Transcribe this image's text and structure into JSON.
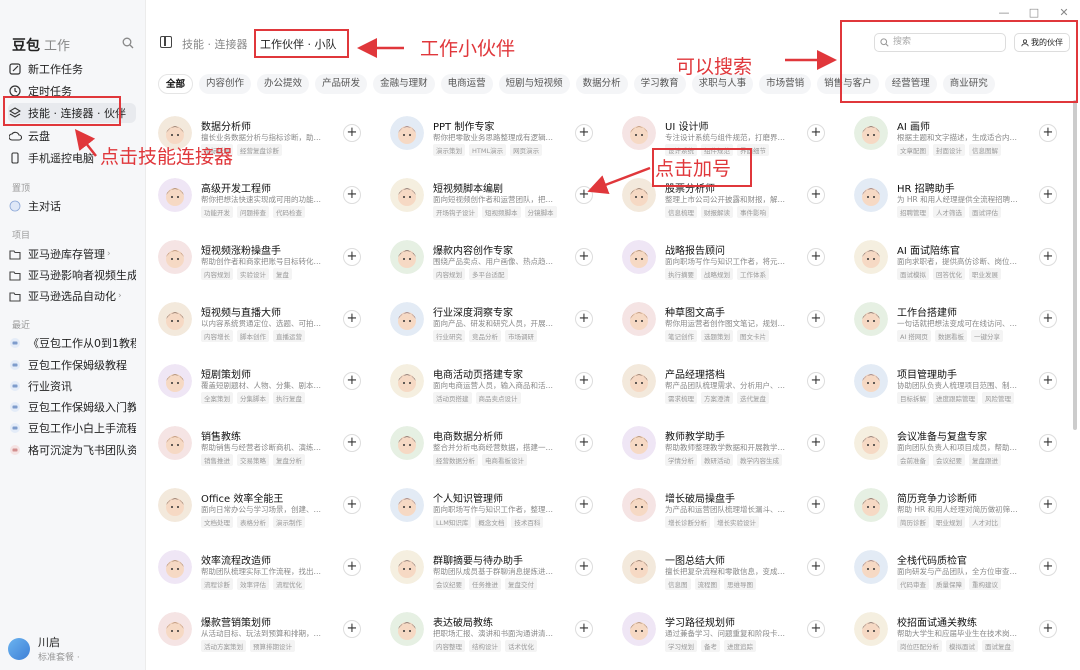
{
  "window": {
    "minimize": "—",
    "maximize": "□",
    "close": "✕"
  },
  "sidebar": {
    "brand": "豆包",
    "brand_sub": "工作",
    "items": [
      {
        "label": "新工作任务",
        "icon": "edit-icon"
      },
      {
        "label": "定时任务",
        "icon": "clock-icon"
      },
      {
        "label": "技能 · 连接器 · 伙伴",
        "icon": "layers-icon",
        "active": true
      },
      {
        "label": "云盘",
        "icon": "cloud-icon"
      },
      {
        "label": "手机遥控电脑",
        "icon": "phone-icon"
      }
    ],
    "section_pinned": "置顶",
    "pinned": [
      {
        "label": "主对话"
      }
    ],
    "section_projects": "项目",
    "projects": [
      {
        "label": "亚马逊库存管理"
      },
      {
        "label": "亚马逊影响者视频生成"
      },
      {
        "label": "亚马逊选品自动化"
      }
    ],
    "section_recent": "最近",
    "recent": [
      {
        "label": "《豆包工作从0到1教程》"
      },
      {
        "label": "豆包工作保姆级教程"
      },
      {
        "label": "行业资讯"
      },
      {
        "label": "豆包工作保姆级入门教程"
      },
      {
        "label": "豆包工作小白上手流程"
      },
      {
        "label": "格可沉淀为飞书团队资产"
      }
    ],
    "user_name": "川启",
    "user_plan": "标准套餐 ·"
  },
  "topbar": {
    "crumb": "技能 · 连接器",
    "active": "工作伙伴 · 小队",
    "search_placeholder": "搜索",
    "partner_label": "我的伙伴"
  },
  "categories": [
    "全部",
    "内容创作",
    "办公提效",
    "产品研发",
    "金融与理财",
    "电商运营",
    "短剧与短视频",
    "数据分析",
    "学习教育",
    "求职与人事",
    "市场营销",
    "销售与客户",
    "经营管理",
    "商业研究"
  ],
  "cards": [
    {
      "name": "数据分析师",
      "desc": "擅长业务数据分析与指标诊断，助…",
      "tags": [
        "指标拆解",
        "经营复盘诊断"
      ]
    },
    {
      "name": "PPT 制作专家",
      "desc": "帮你把零散业务思路整理成有逻辑…",
      "tags": [
        "演示策划",
        "HTML演示",
        "网页演示"
      ]
    },
    {
      "name": "UI 设计师",
      "desc": "专注设计系统与组件规范，打磨界…",
      "tags": [
        "设计系统",
        "组件规范",
        "界面细节"
      ]
    },
    {
      "name": "AI 画师",
      "desc": "根据主题和文字描述，生成适合内…",
      "tags": [
        "文章配图",
        "封面设计",
        "信息图解"
      ]
    },
    {
      "name": "高级开发工程师",
      "desc": "帮你把想法快速实现成可用的功能…",
      "tags": [
        "功能开发",
        "问题排查",
        "代码检查"
      ]
    },
    {
      "name": "短视频脚本编剧",
      "desc": "面向短视频创作者和运营团队，把…",
      "tags": [
        "开场钩子设计",
        "短视频脚本",
        "分镜脚本"
      ]
    },
    {
      "name": "股票分析师",
      "desc": "整理上市公司公开披露和财报，解…",
      "tags": [
        "信息梳理",
        "财报解读",
        "事件影响"
      ]
    },
    {
      "name": "HR 招聘助手",
      "desc": "为 HR 和用人经理提供全流程招聘…",
      "tags": [
        "招聘管理",
        "人才筛选",
        "面试评估"
      ]
    },
    {
      "name": "短视频涨粉操盘手",
      "desc": "帮助创作者和商家把账号目标转化…",
      "tags": [
        "内容规划",
        "实验设计",
        "复盘"
      ]
    },
    {
      "name": "爆款内容创作专家",
      "desc": "围绕产品卖点、用户画像、热点趋…",
      "tags": [
        "内容规划",
        "多平台适配"
      ]
    },
    {
      "name": "战略报告顾问",
      "desc": "面向职场写作与知识工作者，将元…",
      "tags": [
        "执行摘要",
        "战略规划",
        "工作体系"
      ]
    },
    {
      "name": "AI 面试陪练官",
      "desc": "面向求职者，提供高仿诊断、岗位…",
      "tags": [
        "面试模拟",
        "回答优化",
        "职业发展"
      ]
    },
    {
      "name": "短视频与直播大师",
      "desc": "以内容系统贯通定位、选题、可拍…",
      "tags": [
        "内容增长",
        "脚本创作",
        "直播运营"
      ]
    },
    {
      "name": "行业深度洞察专家",
      "desc": "面向产品、研发和研究人员，开展…",
      "tags": [
        "行业研究",
        "竞品分析",
        "市场调研"
      ]
    },
    {
      "name": "种草图文高手",
      "desc": "帮你用运营者创作图文笔记，规划…",
      "tags": [
        "笔记创作",
        "选题策划",
        "图文卡片"
      ]
    },
    {
      "name": "工作台搭建师",
      "desc": "一句话就把想法变成可在线访问、…",
      "tags": [
        "AI 搭网页",
        "数据看板",
        "一键分享"
      ]
    },
    {
      "name": "短剧策划师",
      "desc": "覆盖短剧题材、人物、分集、剧本…",
      "tags": [
        "全案策划",
        "分集脚本",
        "执行复盘"
      ]
    },
    {
      "name": "电商活动页搭建专家",
      "desc": "面向电商运营人员，输入商品和活…",
      "tags": [
        "活动页搭建",
        "商品卖点设计"
      ]
    },
    {
      "name": "产品经理搭档",
      "desc": "帮产品团队梳理需求、分析用户、…",
      "tags": [
        "需求梳理",
        "方案澄清",
        "迭代复盘"
      ]
    },
    {
      "name": "项目管理助手",
      "desc": "协助团队负责人梳理项目范围、制…",
      "tags": [
        "目标拆解",
        "进度跟踪管理",
        "风险管理"
      ]
    },
    {
      "name": "销售教练",
      "desc": "帮助销售与经营者诊断商机、演练…",
      "tags": [
        "销售推进",
        "交易策略",
        "复盘分析"
      ]
    },
    {
      "name": "电商数据分析师",
      "desc": "整合并分析电商经营数据，搭建一…",
      "tags": [
        "经营数据分析",
        "电商看板设计"
      ]
    },
    {
      "name": "教师教学助手",
      "desc": "帮助教师整理教学数据和开展教学…",
      "tags": [
        "学情分析",
        "教研活动",
        "教学内容生成"
      ]
    },
    {
      "name": "会议准备与复盘专家",
      "desc": "面向团队负责人和项目成员，帮助…",
      "tags": [
        "会前准备",
        "会议纪要",
        "复盘跟进"
      ]
    },
    {
      "name": "Office 效率全能王",
      "desc": "面向日常办公与学习场景，创建、…",
      "tags": [
        "文档处理",
        "表格分析",
        "演示制作"
      ]
    },
    {
      "name": "个人知识管理师",
      "desc": "面向职场写作与知识工作者，整理…",
      "tags": [
        "LLM知识库",
        "概念文档",
        "技术百科"
      ]
    },
    {
      "name": "增长破局操盘手",
      "desc": "为产品和运营团队梳理增长漏斗、…",
      "tags": [
        "增长诊断分析",
        "增长实验设计"
      ]
    },
    {
      "name": "简历竞争力诊断师",
      "desc": "帮助 HR 和用人经理对简历做初筛…",
      "tags": [
        "简历诊断",
        "职业规划",
        "人才对比"
      ]
    },
    {
      "name": "效率流程改造师",
      "desc": "帮助团队梳理实际工作流程，找出…",
      "tags": [
        "流程诊断",
        "效率评估",
        "流程优化"
      ]
    },
    {
      "name": "群聊摘要与待办助手",
      "desc": "帮助团队成员基于群聊消息提炼进…",
      "tags": [
        "会议纪要",
        "任务推进",
        "复盘交付"
      ]
    },
    {
      "name": "一图总结大师",
      "desc": "擅长把复杂流程和零散信息，变成…",
      "tags": [
        "信息图",
        "流程图",
        "思维导图"
      ]
    },
    {
      "name": "全栈代码质检官",
      "desc": "面向研发与产品团队，全方位审查…",
      "tags": [
        "代码审查",
        "质量保障",
        "重构建议"
      ]
    },
    {
      "name": "爆款营销策划师",
      "desc": "从活动目标、玩法到预算和排期，…",
      "tags": [
        "活动方案策划",
        "预算排期设计"
      ]
    },
    {
      "name": "表达破局教练",
      "desc": "把职场汇报、演讲和书面沟通讲清…",
      "tags": [
        "内容整理",
        "结构设计",
        "话术优化"
      ]
    },
    {
      "name": "学习路径规划师",
      "desc": "通过兼备学习、问题重复和阶段卡…",
      "tags": [
        "学习规划",
        "备考",
        "进度追踪"
      ]
    },
    {
      "name": "校招面试通关教练",
      "desc": "帮助大学生和应届毕业生在技术岗…",
      "tags": [
        "岗位匹配分析",
        "模拟面试",
        "面试复盘"
      ]
    }
  ],
  "annotations": {
    "a1": "点击技能连接器",
    "a2": "工作小伙伴",
    "a3": "可以搜索",
    "a4": "点击加号"
  },
  "colors": {
    "annotation": "#e0373b",
    "sidebar_bg": "#f6f7f9"
  }
}
